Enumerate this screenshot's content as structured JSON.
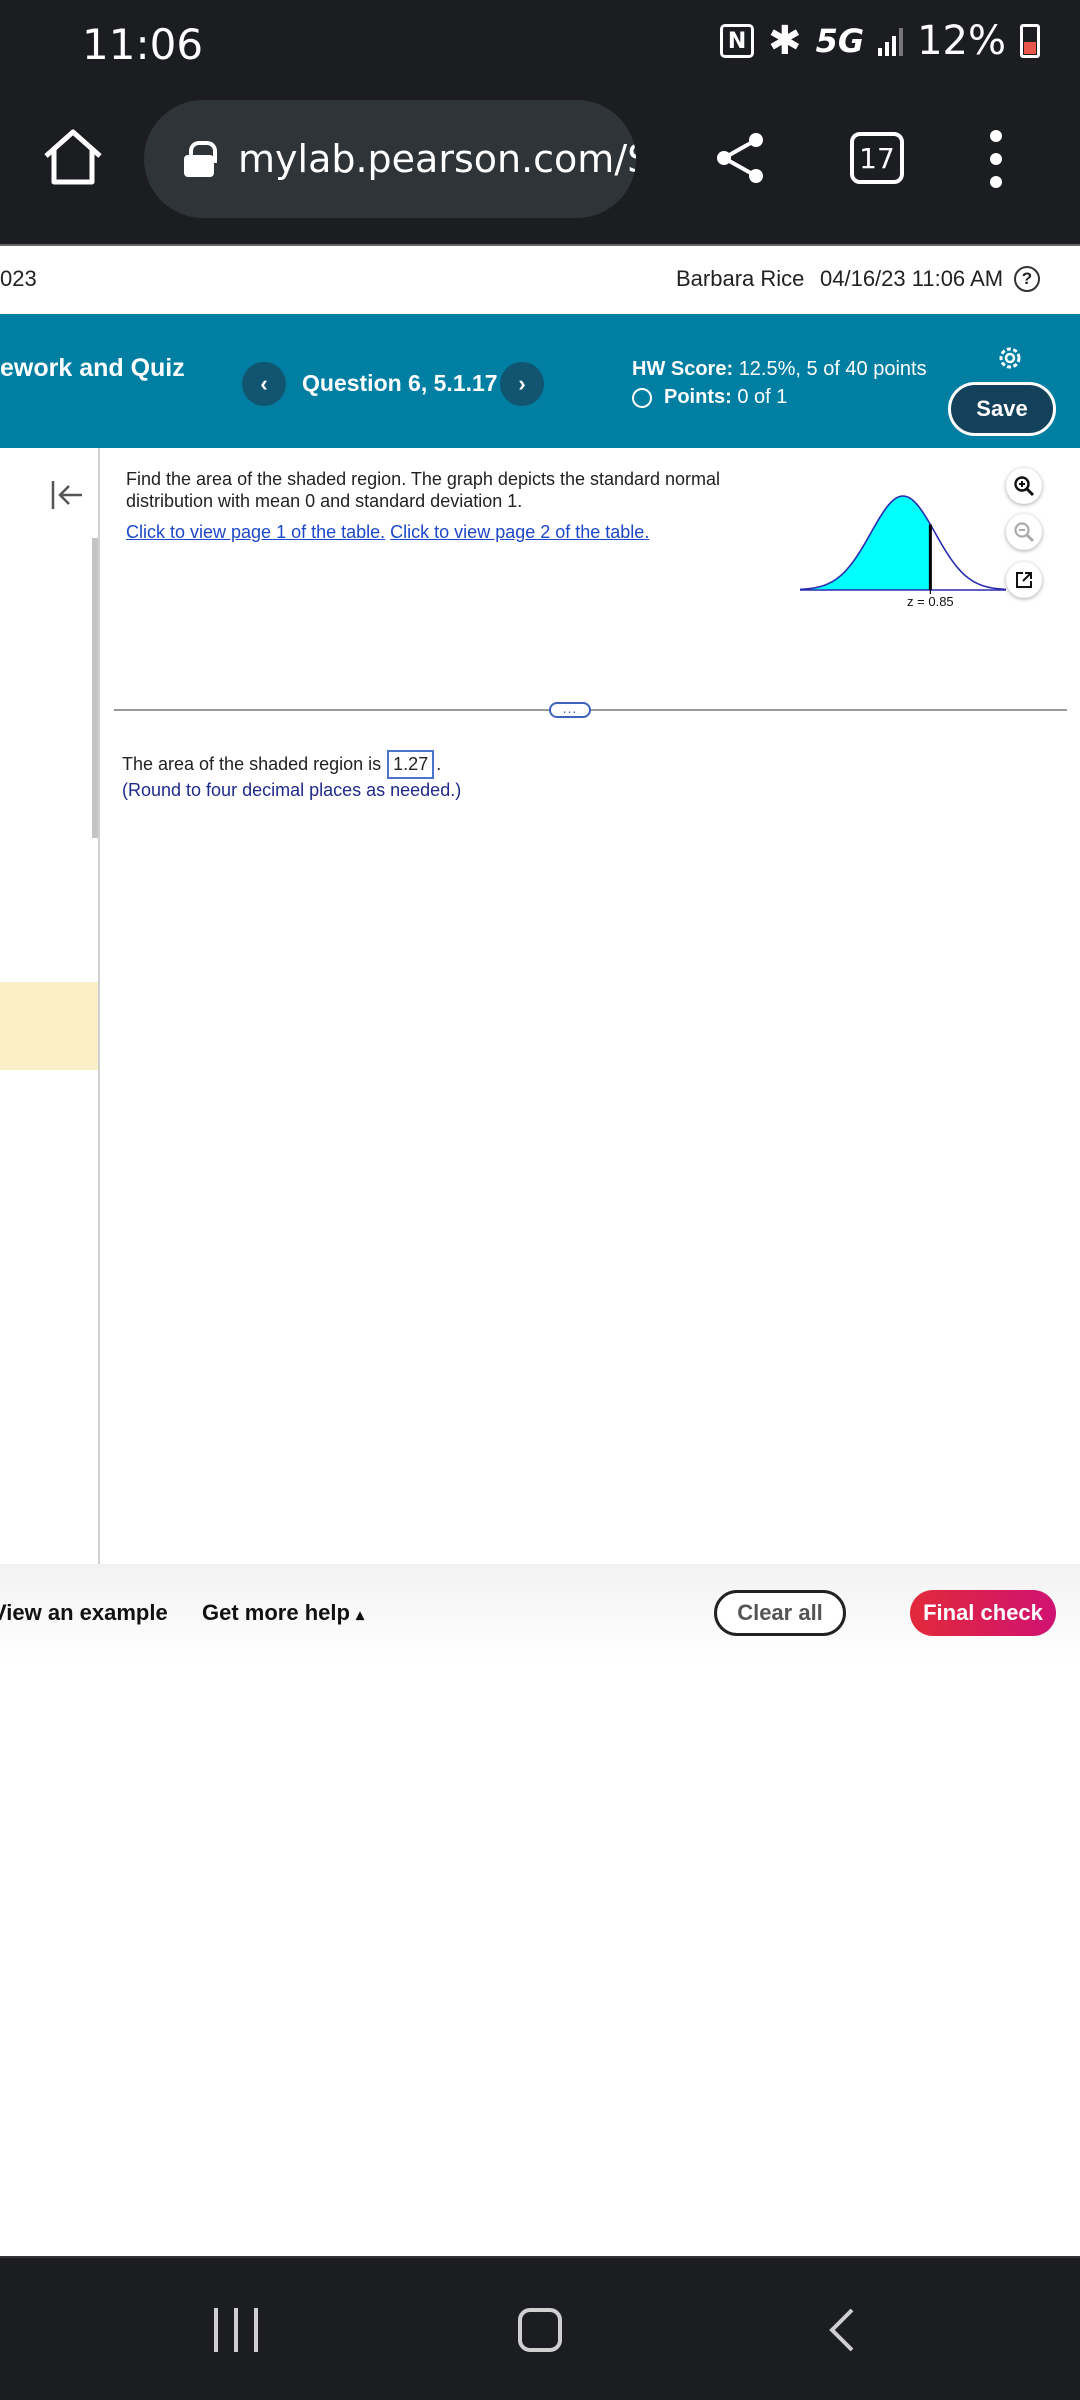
{
  "status_bar": {
    "time": "11:06",
    "network": "5G",
    "battery": "12%"
  },
  "browser": {
    "url": "mylab.pearson.com/S",
    "tab_count": "17"
  },
  "header": {
    "date_fragment": "023",
    "user": "Barbara Rice",
    "datetime": "04/16/23 11:06 AM",
    "help_glyph": "?"
  },
  "assignment": {
    "title": "ework and Quiz",
    "question": "Question 6, 5.1.17",
    "hw_score_label": "HW Score:",
    "hw_score_value": "12.5%, 5 of 40 points",
    "points_label": "Points:",
    "points_value": "0 of 1",
    "save_label": "Save"
  },
  "question": {
    "text": "Find the area of the shaded region. The graph depicts the standard normal distribution with mean 0 and standard deviation 1.",
    "link1": "Click to view page 1 of the table.",
    "link2": "Click to view page 2 of the table.",
    "graph": {
      "z_label": "z = 0.85",
      "z_value": 0.85,
      "mean": 0,
      "sd": 1,
      "shade": "left",
      "fill_color": "#00ffff"
    }
  },
  "answer": {
    "prefix": "The area of the shaded region is",
    "value": "1.27",
    "suffix": ".",
    "note": "(Round to four decimal places as needed.)"
  },
  "footer": {
    "example": "View an example",
    "help": "Get more help",
    "help_caret": "▴",
    "clear": "Clear all",
    "final": "Final check"
  },
  "colors": {
    "header_teal": "#007fa3",
    "final_check": "#e2293a",
    "link": "#1d47c9",
    "highlight": "#fbefc7"
  }
}
